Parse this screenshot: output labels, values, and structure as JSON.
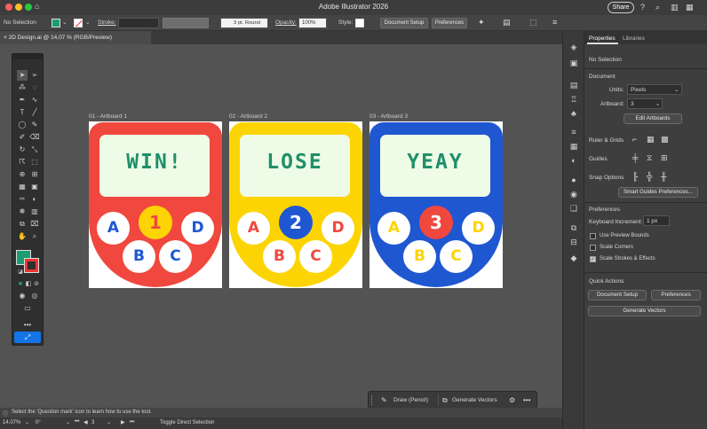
{
  "app": {
    "title": "Adobe Illustrator 2026",
    "share_label": "Share"
  },
  "controlbar": {
    "selection": "No Selection",
    "stroke_label": "Stroke:",
    "brush": "3 pt. Round",
    "opacity_label": "Opacity:",
    "opacity_value": "100%",
    "style_label": "Style:",
    "doc_setup": "Document Setup",
    "preferences": "Preferences"
  },
  "document": {
    "tab_label": "2D Design.ai @ 14,07 % (RGB/Preview)"
  },
  "artboards": [
    {
      "label": "01 - Artboard 1",
      "screen_text": "WIN!",
      "center": "1",
      "letters": [
        "A",
        "D",
        "B",
        "C"
      ],
      "colors": {
        "body": "#f0483e",
        "center_bg": "#fdd403",
        "center_fg": "#f0483e",
        "letters": "#1f57d1",
        "screen_text": "#1f8f6a"
      }
    },
    {
      "label": "02 - Artboard 2",
      "screen_text": "LOSE",
      "center": "2",
      "letters": [
        "A",
        "D",
        "B",
        "C"
      ],
      "colors": {
        "body": "#fdd403",
        "center_bg": "#1f57d1",
        "center_fg": "#ffffff",
        "letters": "#f0483e",
        "screen_text": "#1f8f6a"
      }
    },
    {
      "label": "03 - Artboard 3",
      "screen_text": "YEAY",
      "center": "3",
      "letters": [
        "A",
        "D",
        "B",
        "C"
      ],
      "colors": {
        "body": "#1f57d1",
        "center_bg": "#f0483e",
        "center_fg": "#ffffff",
        "letters": "#fdd403",
        "screen_text": "#1f8f6a"
      }
    }
  ],
  "floatbar": {
    "draw_label": "Draw (Pencil)",
    "generate_label": "Generate Vectors"
  },
  "status": {
    "hint": "Select the 'Question mark' icon to learn how to use the tool.",
    "zoom": "14,07%",
    "rotation": "0°",
    "artboard_num": "3",
    "toggle": "Toggle Direct Selection"
  },
  "panel": {
    "tabs": [
      "Properties",
      "Libraries"
    ],
    "selection": "No Selection",
    "document_header": "Document",
    "units_label": "Units:",
    "units_value": "Pixels",
    "artboard_label": "Artboard:",
    "artboard_value": "3",
    "edit_artboards": "Edit Artboards",
    "ruler_grids": "Ruler & Grids",
    "guides": "Guides",
    "snap_options": "Snap Options",
    "smart_guides": "Smart Guides Preferences...",
    "preferences_header": "Preferences",
    "keyboard_increment_label": "Keyboard Increment:",
    "keyboard_increment_value": "1 px",
    "use_preview_bounds": "Use Preview Bounds",
    "scale_corners": "Scale Corners",
    "scale_strokes": "Scale Strokes & Effects",
    "quick_actions": "Quick Actions",
    "qa_doc_setup": "Document Setup",
    "qa_preferences": "Preferences",
    "qa_generate": "Generate Vectors"
  },
  "colors": {
    "accent": "#1473e6",
    "fill": "#1d9c72",
    "bg": "#535353"
  }
}
